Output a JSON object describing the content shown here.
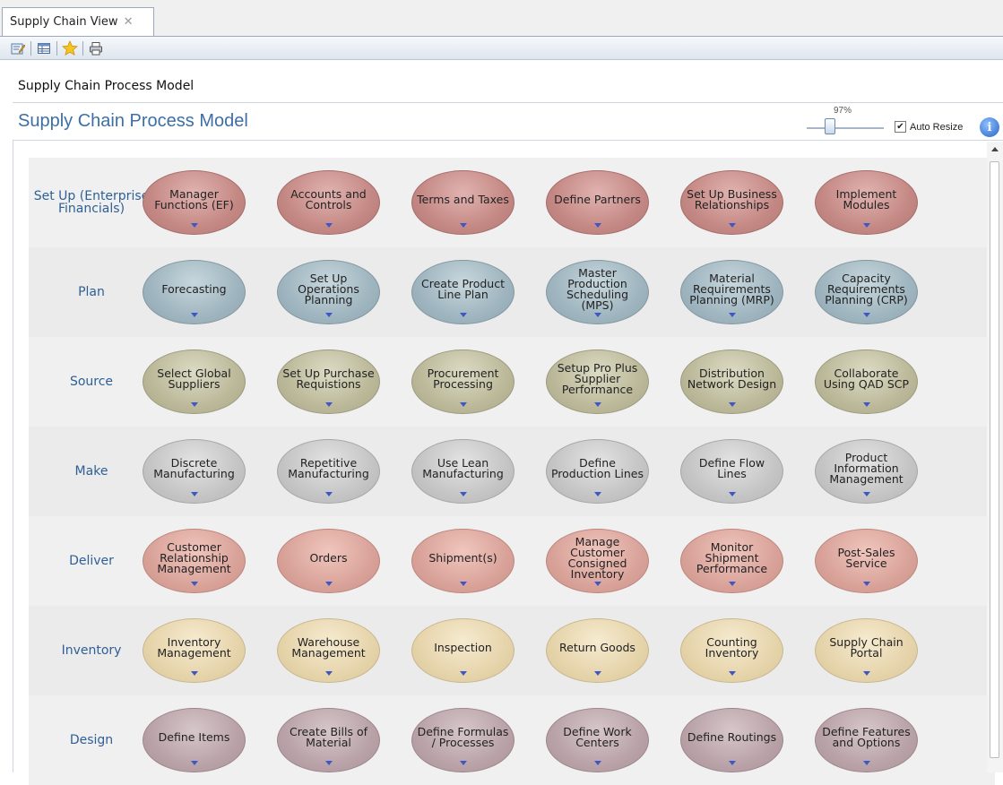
{
  "tab": {
    "title": "Supply Chain View",
    "close": "✕"
  },
  "toolbar": {
    "buttons": [
      {
        "name": "edit-icon",
        "glyph": "✎"
      },
      {
        "name": "grid-icon",
        "glyph": "▦"
      },
      {
        "name": "favorite-star-icon",
        "glyph": "★"
      },
      {
        "name": "print-icon",
        "glyph": "⎙"
      }
    ]
  },
  "breadcrumb": "Supply Chain Process Model",
  "title": "Supply Chain Process Model",
  "zoom": {
    "percent": "97%",
    "level": 0.97
  },
  "auto_resize": {
    "label": "Auto Resize",
    "checked": true
  },
  "info": "i",
  "colors": {
    "title": "#3d6fa6",
    "row_label": "#2e5f95",
    "arrow": "#3e56c8"
  },
  "rows": [
    {
      "label": "Set Up (Enterprise Financials)",
      "color": "red",
      "items": [
        "Manager Functions (EF)",
        "Accounts and Controls",
        "Terms and Taxes",
        "Define Partners",
        "Set Up Business Relationships",
        "Implement Modules"
      ]
    },
    {
      "label": "Plan",
      "color": "blue",
      "items": [
        "Forecasting",
        "Set Up Operations Planning",
        "Create Product Line Plan",
        "Master Production Scheduling (MPS)",
        "Material Requirements Planning (MRP)",
        "Capacity Requirements Planning (CRP)"
      ]
    },
    {
      "label": "Source",
      "color": "olive",
      "items": [
        "Select Global Suppliers",
        "Set Up Purchase Requistions",
        "Procurement Processing",
        "Setup Pro Plus Supplier Performance",
        "Distribution Network Design",
        "Collaborate Using QAD SCP"
      ]
    },
    {
      "label": "Make",
      "color": "gray",
      "items": [
        "Discrete Manufacturing",
        "Repetitive Manufacturing",
        "Use Lean Manufacturing",
        "Define Production Lines",
        "Define Flow Lines",
        "Product Information Management"
      ]
    },
    {
      "label": "Deliver",
      "color": "salmon",
      "items": [
        "Customer Relationship Management",
        "Orders",
        "Shipment(s)",
        "Manage Customer Consigned Inventory",
        "Monitor Shipment Performance",
        "Post-Sales Service"
      ]
    },
    {
      "label": "Inventory",
      "color": "tan",
      "items": [
        "Inventory Management",
        "Warehouse Management",
        "Inspection",
        "Return Goods",
        "Counting Inventory",
        "Supply Chain Portal"
      ]
    },
    {
      "label": "Design",
      "color": "mauve",
      "items": [
        "Define Items",
        "Create Bills of Material",
        "Define Formulas / Processes",
        "Define Work Centers",
        "Define Routings",
        "Define Features and Options"
      ]
    }
  ]
}
